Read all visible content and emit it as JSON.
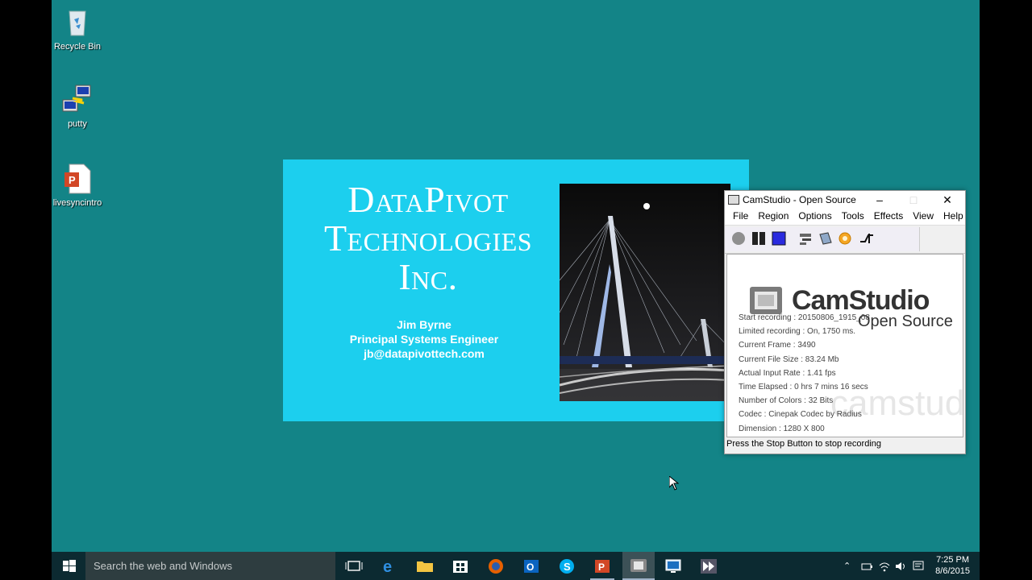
{
  "desktop": {
    "icons": [
      {
        "label": "Recycle Bin",
        "icon": "recycle-bin-icon"
      },
      {
        "label": "putty",
        "icon": "putty-icon"
      },
      {
        "label": "livesyncintro",
        "icon": "powerpoint-file-icon"
      }
    ],
    "background_color": "#138487"
  },
  "slide": {
    "company_line1": "DataPivot",
    "company_line2": "Technologies",
    "company_line3": "Inc.",
    "name": "Jim Byrne",
    "role": "Principal Systems Engineer",
    "email": "jb@datapivottech.com",
    "background_color": "#1ccfee"
  },
  "camstudio": {
    "title": "CamStudio - Open Source",
    "menu": [
      "File",
      "Region",
      "Options",
      "Tools",
      "Effects",
      "View",
      "Help"
    ],
    "logo_main": "CamStudio",
    "logo_sub": "Open Source",
    "watermark": "camstudio.org",
    "info": [
      "Start recording : 20150806_1915_08",
      "Limited recording : On, 1750 ms.",
      "Current Frame : 3490",
      "Current File Size : 83.24 Mb",
      "Actual Input Rate : 1.41 fps",
      "Time Elapsed : 0 hrs 7 mins 16 secs",
      "Number of Colors : 32 Bits",
      "Codec : Cinepak Codec by Radius",
      "Dimension : 1280 X 800"
    ],
    "status": "Press the Stop Button to stop recording"
  },
  "taskbar": {
    "search_placeholder": "Search the web and Windows",
    "time": "7:25 PM",
    "date": "8/6/2015"
  }
}
